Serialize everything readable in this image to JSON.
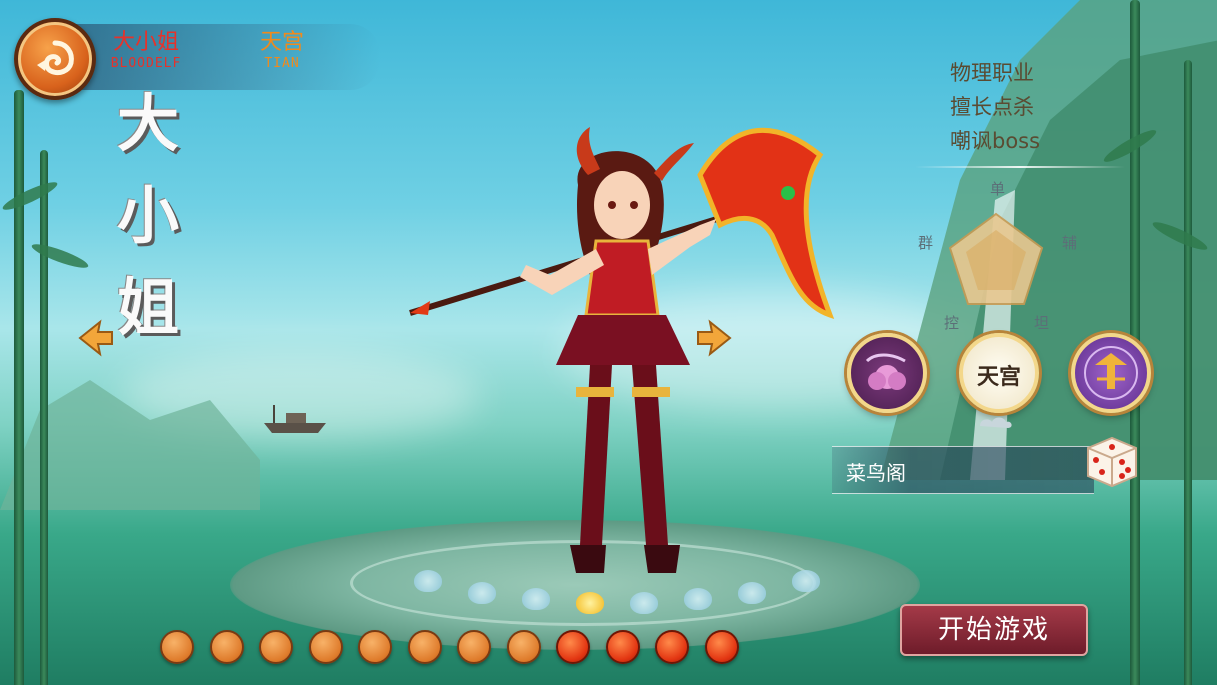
{
  "header": {
    "back_button": "back-swirl-icon",
    "tabs": [
      {
        "cn": "大小姐",
        "en": "BLOODELF"
      },
      {
        "cn": "天宫",
        "en": "TIAN"
      }
    ]
  },
  "character": {
    "name_chars": [
      "大",
      "小",
      "姐"
    ]
  },
  "traits": [
    "物理职业",
    "擅长点杀",
    "嘲讽boss"
  ],
  "radar": {
    "labels": [
      "单",
      "群",
      "辅",
      "控",
      "坦"
    ]
  },
  "sects": [
    {
      "icon": "lotus-cloud-icon",
      "label": ""
    },
    {
      "icon": "tiangong-emblem-icon",
      "label": "天宫"
    },
    {
      "icon": "pagoda-emblem-icon",
      "label": ""
    }
  ],
  "player_name": {
    "value": "菜鸟阁"
  },
  "start_button": {
    "label": "开始游戏"
  },
  "selector": {
    "total": 12,
    "red_from": 9
  },
  "colors": {
    "tab_active": "#e6322b",
    "tab_inactive": "#f08a1c",
    "start_button": "#8a2a38"
  }
}
